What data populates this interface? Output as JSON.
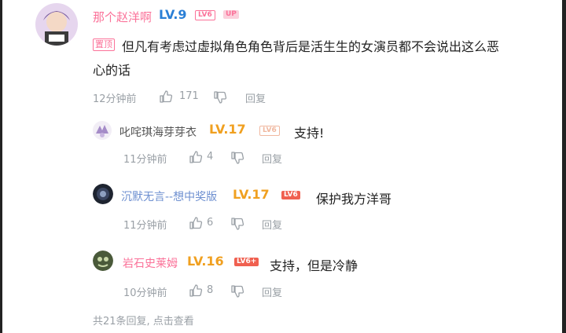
{
  "comment": {
    "username": "那个赵洋啊",
    "level": "LV.9",
    "badge": "LV6",
    "badge2": "UP",
    "pinned_tag": "置顶",
    "text_line1": "但凡有考虑过虚拟角色角色背后是活生生的女演员都不会说出这么恶",
    "text_line2": "心的话",
    "time": "12分钟前",
    "likes": "171",
    "reply_label": "回复"
  },
  "replies": [
    {
      "username": "叱咤琪海芽芽衣",
      "level": "LV.17",
      "badge": "LV6",
      "text": "支持!",
      "time": "11分钟前",
      "likes": "4",
      "reply_label": "回复"
    },
    {
      "username": "沉默无言--想中奖版",
      "level": "LV.17",
      "badge": "LV6",
      "text": "保护我方洋哥",
      "time": "11分钟前",
      "likes": "6",
      "reply_label": "回复"
    },
    {
      "username": "岩石史莱姆",
      "level": "LV.16",
      "badge": "LV6+",
      "text": "支持，但是冷静",
      "time": "10分钟前",
      "likes": "8",
      "reply_label": "回复"
    }
  ],
  "footer": {
    "summary": "共21条回复, 点击查看"
  },
  "colors": {
    "username": "#fb7299",
    "level_main": "#2a7fd6",
    "level_reply": "#f0a020",
    "meta": "#9aa0a6"
  },
  "icons": {
    "like": "thumbs-up-icon",
    "dislike": "thumbs-down-icon"
  }
}
